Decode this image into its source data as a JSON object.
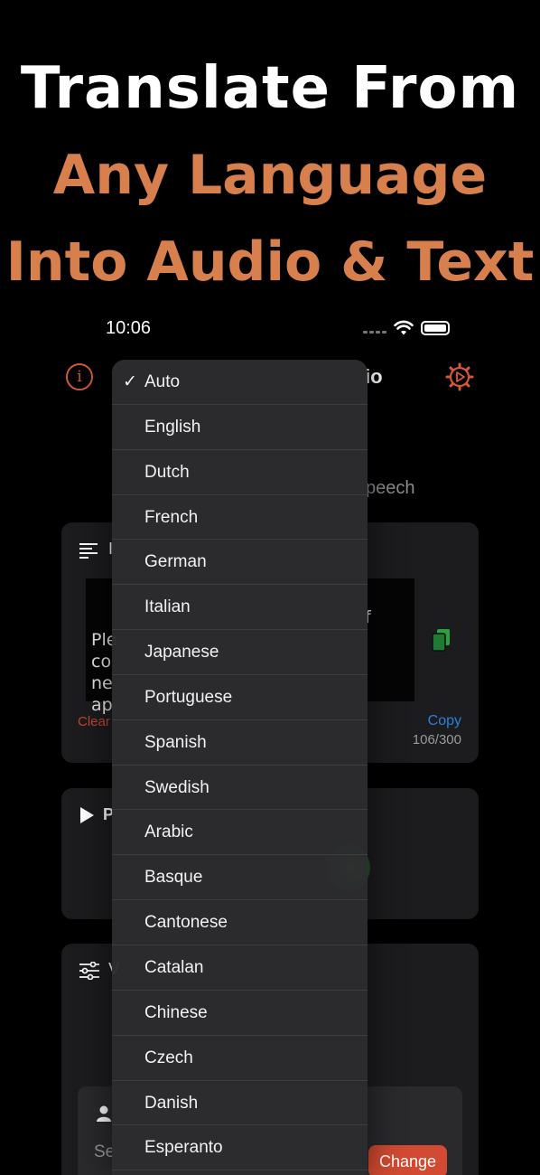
{
  "promo": {
    "line1": "Translate From",
    "line2": "Any Language",
    "line3": "Into Audio & Text",
    "accent_color": "#d7804d"
  },
  "status_bar": {
    "time": "10:06",
    "icons": [
      "cellular-dots-icon",
      "wifi-icon",
      "battery-icon"
    ]
  },
  "nav": {
    "title_visible": "io",
    "left_icon": "info-icon",
    "right_icon": "settings-gear-icon"
  },
  "segment": {
    "visible_label": "peech"
  },
  "text_card": {
    "header_partial": "I",
    "lines": [
      "Ple",
      "co",
      "ne",
      "ap"
    ],
    "right_fragment": "f",
    "clear_label": "Clear",
    "copy_label": "Copy",
    "count": "106/300"
  },
  "play_card": {
    "header_partial": "P"
  },
  "voice_card": {
    "header_partial": "V",
    "select_partial": "Se",
    "change_label": "Change"
  },
  "language_menu": {
    "selected": "Auto",
    "items": [
      "Auto",
      "English",
      "Dutch",
      "French",
      "German",
      "Italian",
      "Japanese",
      "Portuguese",
      "Spanish",
      "Swedish",
      "Arabic",
      "Basque",
      "Cantonese",
      "Catalan",
      "Chinese",
      "Czech",
      "Danish",
      "Esperanto"
    ]
  },
  "colors": {
    "accent_red": "#d5583a",
    "link_blue": "#2f7fd8",
    "copy_green": "#2f9e44"
  }
}
